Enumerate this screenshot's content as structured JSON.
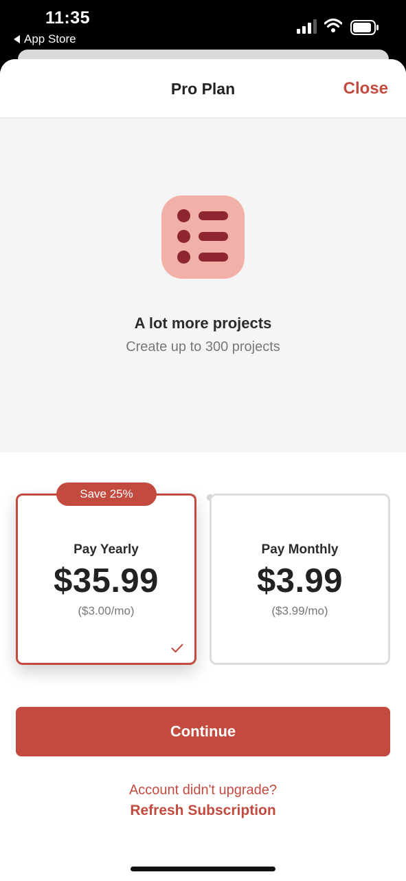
{
  "status_bar": {
    "time": "11:35",
    "back_label": "App Store",
    "icons": [
      "cellular-signal-icon",
      "wifi-icon",
      "battery-icon"
    ]
  },
  "nav": {
    "title": "Pro Plan",
    "close_label": "Close"
  },
  "feature": {
    "icon": "list-icon",
    "title": "A lot more projects",
    "subtitle": "Create up to 300 projects"
  },
  "pager": {
    "total": 8,
    "active_index": 0
  },
  "plans": {
    "yearly": {
      "badge": "Save 25%",
      "name": "Pay Yearly",
      "price": "$35.99",
      "per_month": "($3.00/mo)",
      "selected": true
    },
    "monthly": {
      "name": "Pay Monthly",
      "price": "$3.99",
      "per_month": "($3.99/mo)",
      "selected": false
    }
  },
  "actions": {
    "continue_label": "Continue",
    "account_question": "Account didn't upgrade?",
    "refresh_label": "Refresh Subscription"
  },
  "colors": {
    "accent": "#c24a3f",
    "icon_bg": "#f2b1a8",
    "icon_fg": "#8e2631",
    "carousel_bg": "#f5f5f5"
  }
}
